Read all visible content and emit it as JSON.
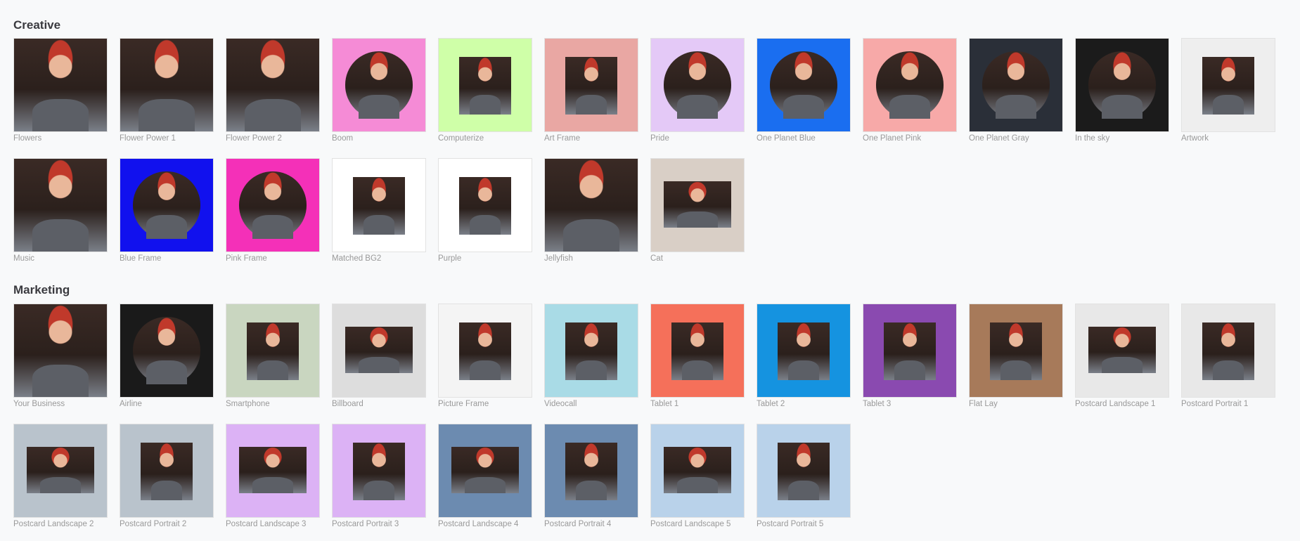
{
  "sections": [
    {
      "title": "Creative",
      "items": [
        {
          "label": "Flowers",
          "bg": "#f1e6ea",
          "frame": "full"
        },
        {
          "label": "Flower Power 1",
          "bg": "#1fb8cc",
          "frame": "full"
        },
        {
          "label": "Flower Power 2",
          "bg": "#8a4a3a",
          "frame": "full"
        },
        {
          "label": "Boom",
          "bg": "#f58bd6",
          "frame": "circle"
        },
        {
          "label": "Computerize",
          "bg": "#cfffa8",
          "frame": "inset"
        },
        {
          "label": "Art Frame",
          "bg": "#e9a7a3",
          "frame": "inset"
        },
        {
          "label": "Pride",
          "bg": "#e4c9f7",
          "frame": "circle"
        },
        {
          "label": "One Planet Blue",
          "bg": "#1a6ef0",
          "frame": "circle"
        },
        {
          "label": "One Planet Pink",
          "bg": "#f7a9a8",
          "frame": "circle"
        },
        {
          "label": "One Planet Gray",
          "bg": "#2a2f38",
          "frame": "circle"
        },
        {
          "label": "In the sky",
          "bg": "#1b1b1b",
          "frame": "circle"
        },
        {
          "label": "Artwork",
          "bg": "#eeeeee",
          "frame": "inset"
        },
        {
          "label": "Music",
          "bg": "#c59a5a",
          "frame": "full"
        },
        {
          "label": "Blue Frame",
          "bg": "#1111ee",
          "frame": "circle"
        },
        {
          "label": "Pink Frame",
          "bg": "#f430b8",
          "frame": "circle"
        },
        {
          "label": "Matched BG2",
          "bg": "#ffffff",
          "frame": "inset"
        },
        {
          "label": "Purple",
          "bg": "#ffffff",
          "frame": "inset"
        },
        {
          "label": "Jellyfish",
          "bg": "#1a9fd0",
          "frame": "full"
        },
        {
          "label": "Cat",
          "bg": "#d9cfc6",
          "frame": "land"
        }
      ]
    },
    {
      "title": "Marketing",
      "items": [
        {
          "label": "Your Business",
          "bg": "#f04a2a",
          "frame": "full"
        },
        {
          "label": "Airline",
          "bg": "#1a1a1a",
          "frame": "circle"
        },
        {
          "label": "Smartphone",
          "bg": "#c9d6c0",
          "frame": "inset"
        },
        {
          "label": "Billboard",
          "bg": "#dddddd",
          "frame": "land"
        },
        {
          "label": "Picture Frame",
          "bg": "#f4f4f4",
          "frame": "inset"
        },
        {
          "label": "Videocall",
          "bg": "#a9dbe6",
          "frame": "inset"
        },
        {
          "label": "Tablet 1",
          "bg": "#f5705a",
          "frame": "inset"
        },
        {
          "label": "Tablet 2",
          "bg": "#1593e0",
          "frame": "inset"
        },
        {
          "label": "Tablet 3",
          "bg": "#8a4ab0",
          "frame": "inset"
        },
        {
          "label": "Flat Lay",
          "bg": "#a77a5a",
          "frame": "inset"
        },
        {
          "label": "Postcard Landscape 1",
          "bg": "#e8e8e8",
          "frame": "land"
        },
        {
          "label": "Postcard Portrait 1",
          "bg": "#e8e8e8",
          "frame": "inset"
        },
        {
          "label": "Postcard Landscape 2",
          "bg": "#b9c3cc",
          "frame": "land"
        },
        {
          "label": "Postcard Portrait 2",
          "bg": "#b9c3cc",
          "frame": "inset"
        },
        {
          "label": "Postcard Landscape 3",
          "bg": "#dcb2f5",
          "frame": "land"
        },
        {
          "label": "Postcard Portrait 3",
          "bg": "#dcb2f5",
          "frame": "inset"
        },
        {
          "label": "Postcard Landscape 4",
          "bg": "#6c8bb0",
          "frame": "land"
        },
        {
          "label": "Postcard Portrait 4",
          "bg": "#6c8bb0",
          "frame": "inset"
        },
        {
          "label": "Postcard Landscape 5",
          "bg": "#b9d2ea",
          "frame": "land"
        },
        {
          "label": "Postcard Portrait 5",
          "bg": "#b9d2ea",
          "frame": "inset"
        }
      ]
    }
  ]
}
